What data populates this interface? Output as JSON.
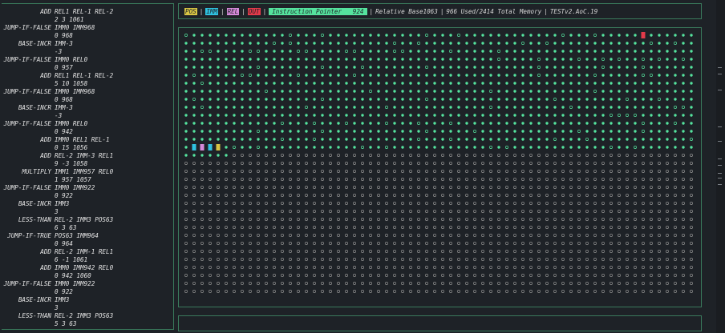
{
  "instructions": [
    {
      "op": "ADD",
      "params": "REL1 REL-1 REL-2",
      "args": "2 3 1061"
    },
    {
      "op": "JUMP-IF-FALSE",
      "params": "IMM0 IMM968",
      "args": "0 968"
    },
    {
      "op": "BASE-INCR",
      "params": "IMM-3",
      "args": "-3"
    },
    {
      "op": "JUMP-IF-FALSE",
      "params": "IMM0 REL0",
      "args": "0 957"
    },
    {
      "op": "ADD",
      "params": "REL1 REL-1 REL-2",
      "args": "5 10 1058"
    },
    {
      "op": "JUMP-IF-FALSE",
      "params": "IMM0 IMM968",
      "args": "0 968"
    },
    {
      "op": "BASE-INCR",
      "params": "IMM-3",
      "args": "-3"
    },
    {
      "op": "JUMP-IF-FALSE",
      "params": "IMM0 REL0",
      "args": "0 942"
    },
    {
      "op": "ADD",
      "params": "IMM0 REL1 REL-1",
      "args": "0 15 1056"
    },
    {
      "op": "ADD",
      "params": "REL-2 IMM-3 REL1",
      "args": "9 -3 1058"
    },
    {
      "op": "MULTIPLY",
      "params": "IMM1 IMM957 REL0",
      "args": "1 957 1057"
    },
    {
      "op": "JUMP-IF-FALSE",
      "params": "IMM0 IMM922",
      "args": "0 922"
    },
    {
      "op": "BASE-INCR",
      "params": "IMM3",
      "args": "3"
    },
    {
      "op": "LESS-THAN",
      "params": "REL-2 IMM3 POS63",
      "args": "6 3 63"
    },
    {
      "op": "JUMP-IF-TRUE",
      "params": "POS63 IMM964",
      "args": "0 964"
    },
    {
      "op": "ADD",
      "params": "REL-2 IMM-1 REL1",
      "args": "6 -1 1061"
    },
    {
      "op": "ADD",
      "params": "IMM0 IMM942 REL0",
      "args": "0 942 1060"
    },
    {
      "op": "JUMP-IF-FALSE",
      "params": "IMM0 IMM922",
      "args": "0 922"
    },
    {
      "op": "BASE-INCR",
      "params": "IMM3",
      "args": "3"
    },
    {
      "op": "LESS-THAN",
      "params": "REL-2 IMM3 POS63",
      "args": "5 3 63"
    }
  ],
  "status": {
    "pos_label": "POS",
    "imm_label": "IMM",
    "rel_label": "REL",
    "out_label": "OUT",
    "ip_label": "Instruction Pointer",
    "ip_value": "924",
    "rel_base_label": "Relative Base",
    "rel_base_value": "1063",
    "memory_text": "966 Used/2414 Total Memory",
    "program_name": "TESTv2.AoC.19"
  },
  "memory": {
    "columns": 64,
    "rows": 33,
    "used_cells": 966,
    "total_cells": 2414,
    "highlight": [
      {
        "row": 0,
        "col": 57,
        "kind": "OUT"
      },
      {
        "row": 14,
        "col": 1,
        "kind": "IMM"
      },
      {
        "row": 14,
        "col": 2,
        "kind": "REL"
      },
      {
        "row": 14,
        "col": 3,
        "kind": "IMM"
      },
      {
        "row": 14,
        "col": 4,
        "kind": "POS"
      }
    ]
  },
  "colors": {
    "border": "#3a7a5c",
    "used_cell": "#55e39e",
    "empty_cell": "#8e8e8e",
    "pos": "#d7c444",
    "imm": "#2fc2e0",
    "rel": "#d68ad9",
    "out": "#e43a4a",
    "ip": "#55e39e"
  }
}
